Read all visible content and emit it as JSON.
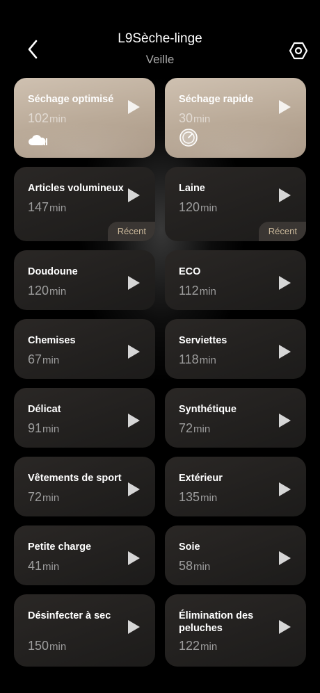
{
  "header": {
    "title": "L9Sèche-linge",
    "status": "Veille",
    "back_icon": "chevron-left-icon",
    "settings_icon": "hexagon-settings-icon"
  },
  "programs": [
    {
      "name": "Séchage optimisé",
      "time": "102",
      "unit": "min",
      "style": "featured",
      "icon": "cloud-sensor-icon"
    },
    {
      "name": "Séchage rapide",
      "time": "30",
      "unit": "min",
      "style": "featured",
      "icon": "gauge-icon"
    },
    {
      "name": "Articles volumineux",
      "time": "147",
      "unit": "min",
      "style": "tall",
      "badge": "Récent"
    },
    {
      "name": "Laine",
      "time": "120",
      "unit": "min",
      "style": "tall",
      "badge": "Récent"
    },
    {
      "name": "Doudoune",
      "time": "120",
      "unit": "min",
      "style": "std"
    },
    {
      "name": "ECO",
      "time": "112",
      "unit": "min",
      "style": "std"
    },
    {
      "name": "Chemises",
      "time": "67",
      "unit": "min",
      "style": "std"
    },
    {
      "name": "Serviettes",
      "time": "118",
      "unit": "min",
      "style": "std"
    },
    {
      "name": "Délicat",
      "time": "91",
      "unit": "min",
      "style": "std"
    },
    {
      "name": "Synthétique",
      "time": "72",
      "unit": "min",
      "style": "std"
    },
    {
      "name": "Vêtements de sport",
      "time": "72",
      "unit": "min",
      "style": "std"
    },
    {
      "name": "Extérieur",
      "time": "135",
      "unit": "min",
      "style": "std"
    },
    {
      "name": "Petite charge",
      "time": "41",
      "unit": "min",
      "style": "std"
    },
    {
      "name": "Soie",
      "time": "58",
      "unit": "min",
      "style": "std"
    },
    {
      "name": "Désinfecter à sec",
      "time": "150",
      "unit": "min",
      "style": "big"
    },
    {
      "name": "Élimination des peluches",
      "time": "122",
      "unit": "min",
      "style": "big"
    }
  ],
  "colors": {
    "background": "#000000",
    "card": "#252321",
    "featured_card": "#c2b3a2",
    "badge_text": "#c9b79a"
  }
}
